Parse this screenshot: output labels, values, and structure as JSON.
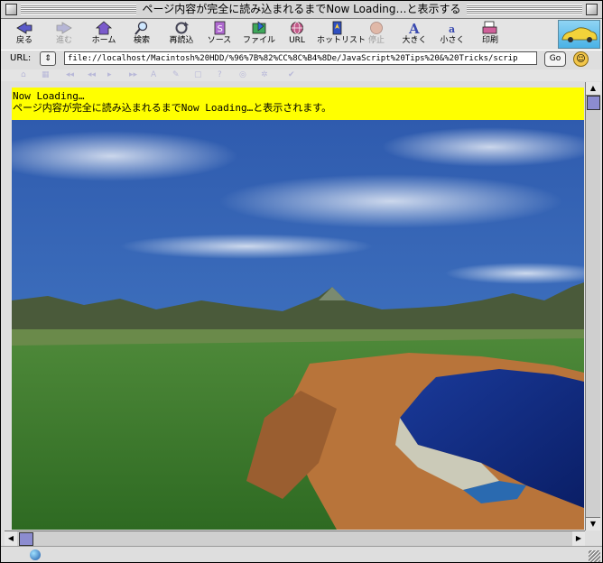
{
  "window": {
    "title": "ページ内容が完全に読み込まれるまでNow Loading…と表示する"
  },
  "toolbar": {
    "buttons": [
      {
        "label": "戻る",
        "icon": "back-arrow-icon",
        "disabled": false
      },
      {
        "label": "進む",
        "icon": "forward-arrow-icon",
        "disabled": true
      },
      {
        "label": "ホーム",
        "icon": "home-icon",
        "disabled": false
      },
      {
        "label": "検索",
        "icon": "search-icon",
        "disabled": false
      },
      {
        "label": "再読込",
        "icon": "reload-icon",
        "disabled": false
      },
      {
        "label": "ソース",
        "icon": "source-icon",
        "disabled": false
      },
      {
        "label": "ファイル",
        "icon": "file-icon",
        "disabled": false
      },
      {
        "label": "URL",
        "icon": "url-globe-icon",
        "disabled": false
      },
      {
        "label": "ホットリスト",
        "icon": "hotlist-icon",
        "disabled": false
      },
      {
        "label": "停止",
        "icon": "stop-icon",
        "disabled": true
      },
      {
        "label": "大きく",
        "icon": "bigger-text-icon",
        "disabled": false
      },
      {
        "label": "小さく",
        "icon": "smaller-text-icon",
        "disabled": false
      },
      {
        "label": "印刷",
        "icon": "print-icon",
        "disabled": false
      }
    ]
  },
  "address": {
    "label": "URL:",
    "value": "file://localhost/Macintosh%20HDD/%96%7B%82%CC%8C%B4%8De/JavaScript%20Tips%20&%20Tricks/scrip",
    "go_label": "Go"
  },
  "page": {
    "loading_line1": "Now Loading…",
    "loading_line2": "ページ内容が完全に読み込まれるまでNow Loading…と表示されます。"
  },
  "colors": {
    "loading_bg": "#ffff00",
    "sky": "#3a6ab6",
    "grass": "#3e7a2c",
    "lake": "#102e8a",
    "rock": "#b8743a"
  }
}
